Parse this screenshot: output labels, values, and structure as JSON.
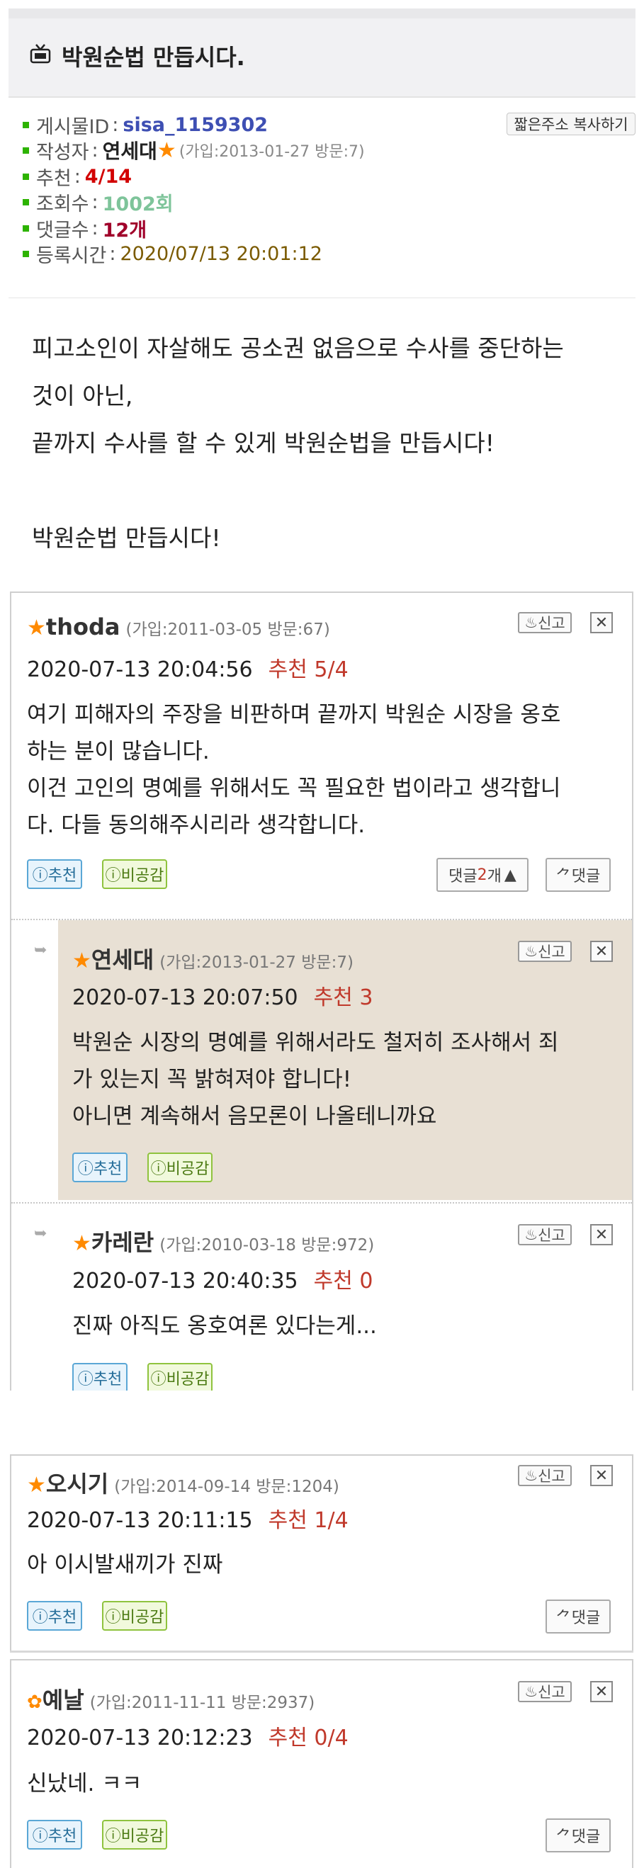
{
  "post": {
    "title": "박원순법 만듭시다.",
    "short_url_button": "짧은주소 복사하기",
    "meta": {
      "id_label": "게시물ID",
      "id_value": "sisa_1159302",
      "author_label": "작성자",
      "author_value": "연세대",
      "author_join": "(가입:2013-01-27 방문:7)",
      "rec_label": "추천",
      "rec_value": "4/14",
      "view_label": "조회수",
      "view_value": "1002회",
      "cmt_label": "댓글수",
      "cmt_value": "12개",
      "time_label": "등록시간",
      "time_value": "2020/07/13 20:01:12"
    },
    "body": [
      "피고소인이 자살해도 공소권 없음으로 수사를 중단하는",
      "것이 아닌,",
      "끝까지 수사를 할 수 있게 박원순법을 만듭시다!",
      "",
      "박원순법 만듭시다!"
    ]
  },
  "labels": {
    "report": "신고",
    "recommend": "추천",
    "dislike": "비공감",
    "reply": "댓글",
    "replies_prefix": "댓글 ",
    "replies_suffix": "개",
    "rec_prefix": "추천 "
  },
  "comments": [
    {
      "name": "thoda",
      "join": "(가입:2011-03-05 방문:67)",
      "date": "2020-07-13 20:04:56",
      "rec": "5/4",
      "text": [
        "여기 피해자의 주장을 비판하며 끝까지 박원순 시장을 옹호",
        "하는 분이 많습니다.",
        "이건 고인의 명예를 위해서도 꼭 필요한 법이라고 생각합니",
        "다. 다들 동의해주시리라 생각합니다."
      ],
      "reply_count": "2"
    },
    {
      "name": "연세대",
      "join": "(가입:2013-01-27 방문:7)",
      "date": "2020-07-13 20:07:50",
      "rec": "3",
      "text": [
        "박원순 시장의 명예를 위해서라도 철저히 조사해서 죄",
        "가 있는지 꼭 밝혀져야 합니다!",
        "아니면 계속해서 음모론이 나올테니까요"
      ]
    },
    {
      "name": "카레란",
      "join": "(가입:2010-03-18 방문:972)",
      "date": "2020-07-13 20:40:35",
      "rec": "0",
      "text": [
        "진짜 아직도 옹호여론 있다는게..."
      ]
    },
    {
      "name": "오시기",
      "join": "(가입:2014-09-14 방문:1204)",
      "date": "2020-07-13 20:11:15",
      "rec": "1/4",
      "text": [
        "아 이시발새끼가 진짜"
      ]
    },
    {
      "name": "예날",
      "join": "(가입:2011-11-11 방문:2937)",
      "date": "2020-07-13 20:12:23",
      "rec": "0/4",
      "text": [
        "신났네. ㅋㅋ"
      ]
    }
  ]
}
